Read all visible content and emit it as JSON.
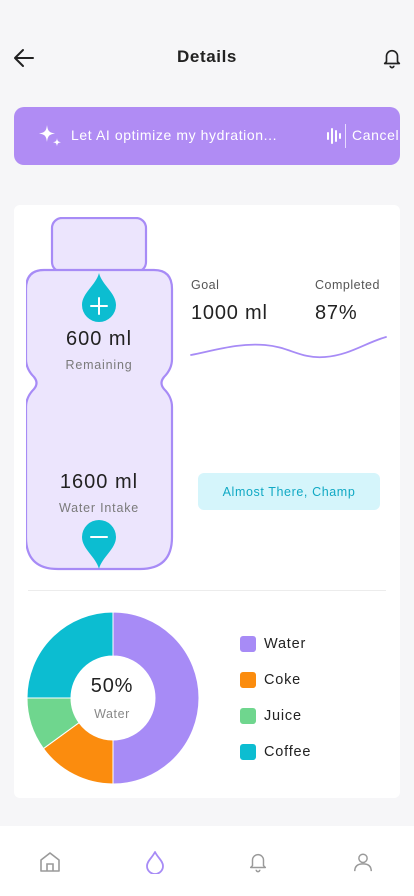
{
  "header": {
    "title": "Details"
  },
  "ai_bar": {
    "prompt": "Let AI optimize my hydration...",
    "cancel_label": "Cancel"
  },
  "bottle": {
    "remaining_value": "600 ml",
    "remaining_label": "Remaining",
    "intake_value": "1600 ml",
    "intake_label": "Water Intake"
  },
  "goal": {
    "goal_label": "Goal",
    "goal_value": "1000 ml",
    "completed_label": "Completed",
    "completed_value": "87%"
  },
  "status_badge": "Almost There, Champ",
  "chart_data": {
    "type": "pie",
    "labels": [
      "Water",
      "Coke",
      "Juice",
      "Coffee"
    ],
    "values": [
      50,
      15,
      10,
      25
    ],
    "colors": [
      "#a78bf6",
      "#fb8c0e",
      "#6fd68e",
      "#0cbdd1"
    ],
    "center_value": "50%",
    "center_label": "Water"
  },
  "legend": [
    {
      "label": "Water",
      "color": "#a78bf6"
    },
    {
      "label": "Coke",
      "color": "#fb8c0e"
    },
    {
      "label": "Juice",
      "color": "#6fd68e"
    },
    {
      "label": "Coffee",
      "color": "#0cbdd1"
    }
  ],
  "colors": {
    "accent": "#b08cf4",
    "teal": "#0cbdd1",
    "bottle_fill": "#ece5fd",
    "bottle_stroke": "#a78bf6"
  },
  "tabbar": {
    "tabs": [
      "home-icon",
      "water-drop-icon",
      "bell-icon",
      "profile-icon"
    ],
    "active": "water-drop-icon"
  }
}
